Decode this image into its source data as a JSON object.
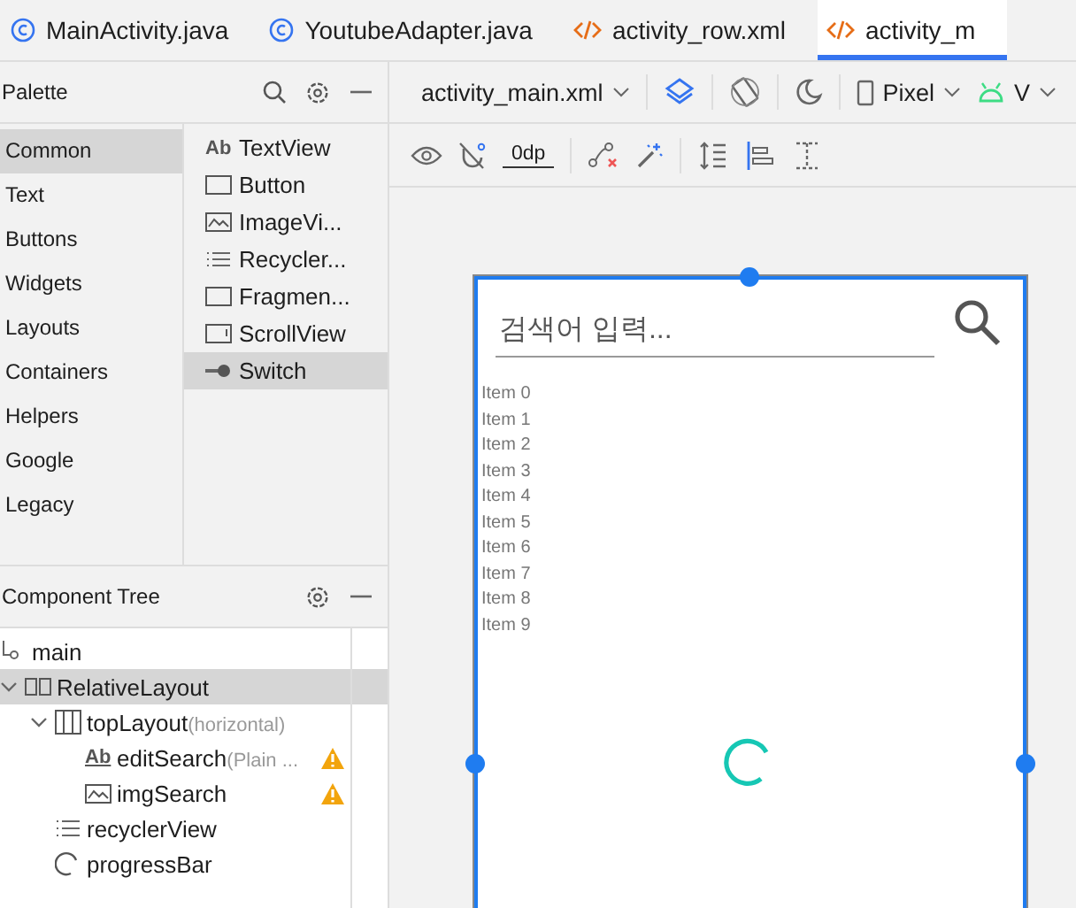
{
  "tabs": [
    {
      "label": "MainActivity.java",
      "kind": "class",
      "selected": false
    },
    {
      "label": "YoutubeAdapter.java",
      "kind": "class",
      "selected": false
    },
    {
      "label": "activity_row.xml",
      "kind": "xml",
      "selected": false
    },
    {
      "label": "activity_m",
      "kind": "xml",
      "selected": true
    }
  ],
  "palette": {
    "title": "Palette",
    "categories": [
      {
        "label": "Common",
        "selected": true
      },
      {
        "label": "Text",
        "selected": false
      },
      {
        "label": "Buttons",
        "selected": false
      },
      {
        "label": "Widgets",
        "selected": false
      },
      {
        "label": "Layouts",
        "selected": false
      },
      {
        "label": "Containers",
        "selected": false
      },
      {
        "label": "Helpers",
        "selected": false
      },
      {
        "label": "Google",
        "selected": false
      },
      {
        "label": "Legacy",
        "selected": false
      }
    ],
    "widgets": [
      {
        "label": "TextView",
        "kind": "text",
        "badge": "Ab",
        "selected": false
      },
      {
        "label": "Button",
        "kind": "button",
        "selected": false
      },
      {
        "label": "ImageVi...",
        "kind": "image",
        "selected": false
      },
      {
        "label": "Recycler...",
        "kind": "list",
        "selected": false
      },
      {
        "label": "Fragmen...",
        "kind": "frame",
        "selected": false
      },
      {
        "label": "ScrollView",
        "kind": "scroll",
        "selected": false
      },
      {
        "label": "Switch",
        "kind": "switch",
        "selected": true
      }
    ]
  },
  "component_tree": {
    "title": "Component Tree",
    "nodes": [
      {
        "label": "main",
        "kind": "root",
        "selected": false
      },
      {
        "label": "RelativeLayout",
        "kind": "relative",
        "selected": true,
        "expanded": true,
        "children": [
          {
            "label": "topLayout",
            "hint": "(horizontal)",
            "kind": "linear",
            "selected": false,
            "expanded": true,
            "children": [
              {
                "label": "editSearch",
                "hint": "(Plain ...",
                "kind": "text",
                "badge": "Ab",
                "selected": false,
                "warning": true
              },
              {
                "label": "imgSearch",
                "kind": "image",
                "selected": false,
                "warning": true
              }
            ]
          },
          {
            "label": "recyclerView",
            "kind": "list",
            "selected": false
          },
          {
            "label": "progressBar",
            "kind": "progress",
            "selected": false
          }
        ]
      }
    ]
  },
  "toolbar": {
    "file": "activity_main.xml",
    "device": "Pixel",
    "api": "V",
    "margin": "0dp"
  },
  "preview": {
    "search_placeholder": "검색어 입력...",
    "items": [
      "Item 0",
      "Item 1",
      "Item 2",
      "Item 3",
      "Item 4",
      "Item 5",
      "Item 6",
      "Item 7",
      "Item 8",
      "Item 9"
    ]
  }
}
